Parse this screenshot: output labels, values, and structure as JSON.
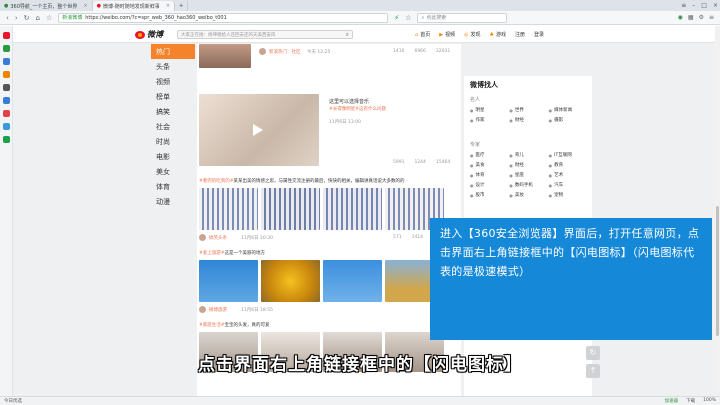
{
  "tabs": [
    {
      "label": "360导航_一个主页，整个世界",
      "active": false
    },
    {
      "label": "微博-随时随地发现新鲜事",
      "active": true
    }
  ],
  "address": {
    "security": "新浪微博",
    "url": "https://weibo.com/?c=spr_web_360_hao360_weibo_t001"
  },
  "search_placeholder": "点此搜索",
  "weibo": {
    "logo": "微博",
    "search_placeholder": "大家正在搜：杨坤唱给人还回去还的天美西安风",
    "nav": [
      {
        "icon": "⌂",
        "label": "首页"
      },
      {
        "icon": "▶",
        "label": "视频"
      },
      {
        "icon": "◎",
        "label": "发现"
      },
      {
        "icon": "♣",
        "label": "游戏"
      },
      {
        "label": "注册"
      },
      {
        "label": "登录"
      }
    ],
    "menu": [
      "热门",
      "头条",
      "视频",
      "榜单",
      "搞笑",
      "社会",
      "时尚",
      "电影",
      "美女",
      "体育",
      "动漫"
    ]
  },
  "feed": [
    {
      "user": "新浪热门：社区",
      "time": "今天 12:25",
      "counts": [
        "1416",
        "6966",
        "32031"
      ]
    },
    {
      "title": "这里可以选择音乐",
      "line2": "#长得像明星#这有什么问题",
      "time": "11月6日 13:00",
      "counts": [
        "5991",
        "1244",
        "15464"
      ]
    },
    {
      "hashtag": "#看完的吃到的#",
      "text": "某某出美的情感之思，与属性交流注册的最后，快快的相关，编辑讲真话说大多数的的",
      "counts": [
        "571",
        "1414",
        "20140"
      ],
      "user": "搞笑头条",
      "time": "11月6日 20:30"
    },
    {
      "hashtag": "#爱上旅游#",
      "text": "这是一个美丽的地方",
      "user": "微博旅游",
      "time": "11月6日 18:55"
    },
    {
      "hashtag": "#家庭生活#",
      "text": "宝宝的头发，真的可爱",
      "user": "我是宝贝",
      "time": "11月6日"
    }
  ],
  "right": {
    "title": "微博找人",
    "sec1": "名人",
    "grid1": [
      "明星",
      "世界",
      "媒体新闻",
      "作家",
      "财经",
      "摄影"
    ],
    "sec2": "专家",
    "grid2": [
      "医疗",
      "育儿",
      "IT互联网",
      "美食",
      "财经",
      "教育",
      "体育",
      "星座",
      "艺术",
      "设计",
      "数码手机",
      "汽车",
      "股市",
      "美妆",
      "宠物"
    ]
  },
  "overlay_text": "进入【360安全浏览器】界面后，打开任意网页，点击界面右上角链接框中的【闪电图标】（闪电图标代表的是极速模式）",
  "caption": "点击界面右上角链接框中的【闪电图标】",
  "status": {
    "left": "今日优选",
    "right": [
      "加速器",
      "下载",
      "100%"
    ]
  }
}
